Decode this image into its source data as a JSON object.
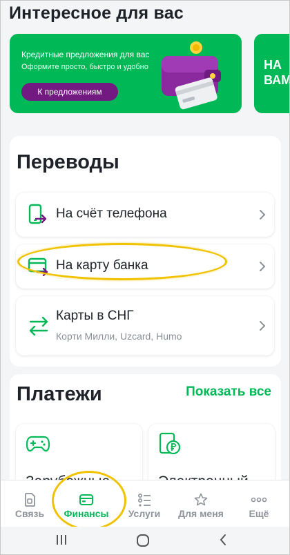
{
  "header": {
    "title": "Интересное для вас"
  },
  "banner": {
    "title": "Кредитные предложения для вас",
    "subtitle": "Оформите просто, быстро и удобно",
    "button_label": "К предложениям"
  },
  "banner2": {
    "text": "НА ВАМ"
  },
  "transfers": {
    "title": "Переводы",
    "items": [
      {
        "label": "На счёт телефона",
        "icon": "phone-transfer-icon"
      },
      {
        "label": "На карту банка",
        "icon": "card-transfer-icon"
      },
      {
        "label": "Карты в СНГ",
        "sublabel": "Корти Милли, Uzcard, Humo",
        "icon": "exchange-arrows-icon"
      }
    ]
  },
  "payments": {
    "title": "Платежи",
    "show_all": "Показать все",
    "tiles": [
      {
        "label": "Зарубежные",
        "icon": "gamepad-icon"
      },
      {
        "label": "Электронный",
        "icon": "ruble-phone-icon"
      }
    ]
  },
  "tabbar": {
    "active": "Финансы",
    "tabs": [
      {
        "label": "Связь",
        "icon": "sim-icon"
      },
      {
        "label": "Финансы",
        "icon": "wallet-icon"
      },
      {
        "label": "Услуги",
        "icon": "list-icon"
      },
      {
        "label": "Для меня",
        "icon": "star-icon"
      },
      {
        "label": "Ещё",
        "icon": "more-icon"
      }
    ]
  },
  "colors": {
    "accent": "#00b956",
    "brand_purple": "#731982",
    "highlight": "#f0c200"
  }
}
